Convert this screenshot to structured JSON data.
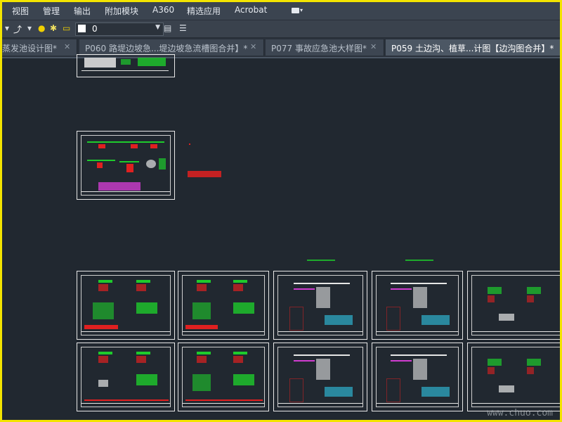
{
  "menu": {
    "items": [
      "视图",
      "管理",
      "输出",
      "附加模块",
      "A360",
      "精选应用",
      "Acrobat"
    ]
  },
  "toolbar": {
    "layer_name": "0"
  },
  "tabs": [
    {
      "label": "蒸发池设计图*",
      "active": false
    },
    {
      "label": "P060 路堤边坡急...堤边坡急流槽图合并】*",
      "active": false
    },
    {
      "label": "P077 事故应急池大样图*",
      "active": false
    },
    {
      "label": "P059 土边沟、植草...计图【边沟图合并】*",
      "active": true
    }
  ],
  "watermark": "www.chuo.com",
  "colors": {
    "highlight_border": "#f3e400",
    "canvas_bg": "#212830",
    "drawing_green": "#1ecb2c",
    "drawing_red": "#e02020",
    "drawing_magenta": "#d03cd0"
  },
  "icons": [
    "polyline-icon",
    "lightbulb-icon",
    "sun-icon",
    "lock-icon",
    "color-swatch",
    "layer-dropdown-icon",
    "layer-properties-icon",
    "overflow-menu-icon",
    "close-tab-icon",
    "mail-icon"
  ]
}
